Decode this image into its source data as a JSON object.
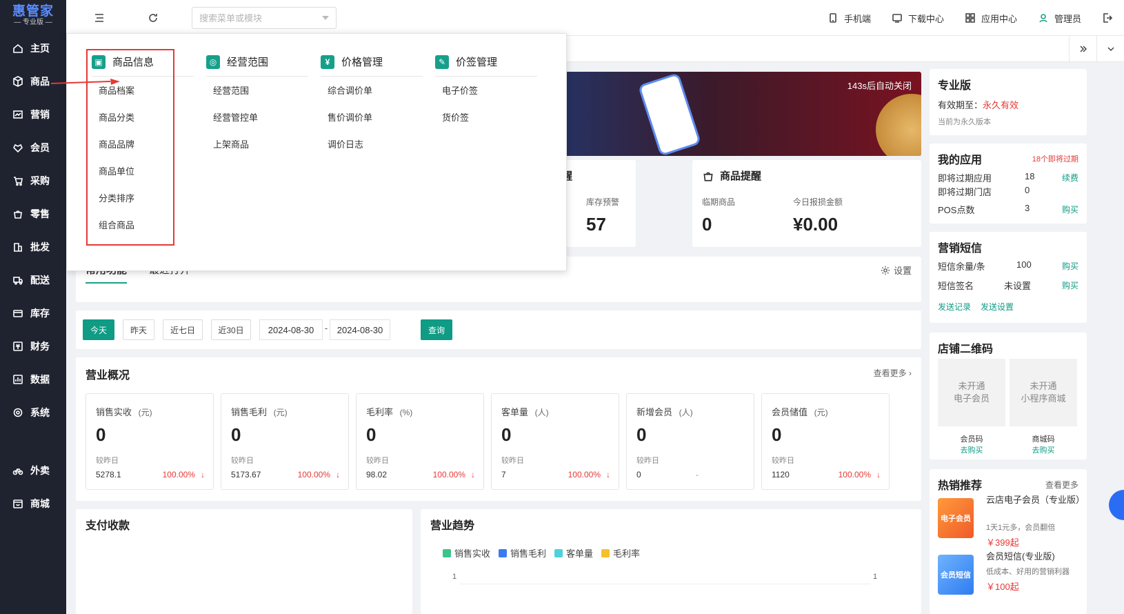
{
  "sidebar": {
    "brand": "惠管家",
    "edition": "— 专业版 —",
    "items": [
      {
        "label": "主页",
        "icon": "home-icon"
      },
      {
        "label": "商品",
        "icon": "cube-icon"
      },
      {
        "label": "营销",
        "icon": "chart-icon"
      },
      {
        "label": "会员",
        "icon": "heart-icon"
      },
      {
        "label": "采购",
        "icon": "cart-icon"
      },
      {
        "label": "零售",
        "icon": "bag-icon"
      },
      {
        "label": "批发",
        "icon": "building-icon"
      },
      {
        "label": "配送",
        "icon": "truck-icon"
      },
      {
        "label": "库存",
        "icon": "box-icon"
      },
      {
        "label": "财务",
        "icon": "money-icon"
      },
      {
        "label": "数据",
        "icon": "data-icon"
      },
      {
        "label": "系统",
        "icon": "gear-icon"
      },
      {
        "label": "外卖",
        "icon": "bike-icon"
      },
      {
        "label": "商城",
        "icon": "store-icon"
      }
    ]
  },
  "topbar": {
    "search_placeholder": "搜索菜单或模块",
    "mobile": "手机端",
    "download": "下载中心",
    "apps": "应用中心",
    "user": "管理员"
  },
  "mega_menu": {
    "columns": [
      {
        "title": "商品信息",
        "icon_char": "▣",
        "items": [
          "商品档案",
          "商品分类",
          "商品品牌",
          "商品单位",
          "分类排序",
          "组合商品"
        ]
      },
      {
        "title": "经营范围",
        "icon_char": "◎",
        "items": [
          "经营范围",
          "经营管控单",
          "上架商品"
        ]
      },
      {
        "title": "价格管理",
        "icon_char": "¥",
        "items": [
          "综合调价单",
          "售价调价单",
          "调价日志"
        ]
      },
      {
        "title": "价签管理",
        "icon_char": "✎",
        "items": [
          "电子价签",
          "货价签"
        ]
      }
    ]
  },
  "banner": {
    "countdown": "143s后自动关闭"
  },
  "stock_card": {
    "label": "库存预警",
    "value": "57",
    "title_frag": "提醒"
  },
  "goods_card": {
    "title": "商品提醒",
    "expiring_label": "临期商品",
    "expiring_value": "0",
    "loss_label": "今日报损金额",
    "loss_value": "¥0.00"
  },
  "functions": {
    "tabs": [
      "常用功能",
      "最近打开"
    ],
    "setting": "设置"
  },
  "filter": {
    "today": "今天",
    "yesterday": "昨天",
    "week": "近七日",
    "month": "近30日",
    "start": "2024-08-30",
    "sep": "-",
    "end": "2024-08-30",
    "query": "查询"
  },
  "overview": {
    "title": "营业概况",
    "more": "查看更多",
    "metrics": [
      {
        "label": "销售实收",
        "unit": "(元)",
        "value": "0",
        "cmp": "较昨日",
        "prev": "5278.1",
        "pct": "100.00%",
        "arrow": "↓"
      },
      {
        "label": "销售毛利",
        "unit": "(元)",
        "value": "0",
        "cmp": "较昨日",
        "prev": "5173.67",
        "pct": "100.00%",
        "arrow": "↓"
      },
      {
        "label": "毛利率",
        "unit": "(%)",
        "value": "0",
        "cmp": "较昨日",
        "prev": "98.02",
        "pct": "100.00%",
        "arrow": "↓"
      },
      {
        "label": "客单量",
        "unit": "(人)",
        "value": "0",
        "cmp": "较昨日",
        "prev": "7",
        "pct": "100.00%",
        "arrow": "↓"
      },
      {
        "label": "新增会员",
        "unit": "(人)",
        "value": "0",
        "cmp": "较昨日",
        "prev": "0",
        "pct": "-",
        "arrow": ""
      },
      {
        "label": "会员储值",
        "unit": "(元)",
        "value": "0",
        "cmp": "较昨日",
        "prev": "1120",
        "pct": "100.00%",
        "arrow": "↓"
      }
    ]
  },
  "payment": {
    "title": "支付收款"
  },
  "trend": {
    "title": "营业趋势",
    "legend": [
      {
        "name": "销售实收",
        "color": "#3cc48a"
      },
      {
        "name": "销售毛利",
        "color": "#3a7bf0"
      },
      {
        "name": "客单量",
        "color": "#4fd1d9"
      },
      {
        "name": "毛利率",
        "color": "#f5c02c"
      }
    ],
    "y_left": "1",
    "y_right": "1"
  },
  "pro": {
    "title": "专业版",
    "validity_label": "有效期至：",
    "validity_value": "永久有效",
    "note": "当前为永久版本"
  },
  "my_apps": {
    "title": "我的应用",
    "expiring": "18个即将过期",
    "rows": [
      {
        "label": "即将过期应用",
        "value": "18",
        "link": "续费"
      },
      {
        "label": "即将过期门店",
        "value": "0",
        "link": ""
      },
      {
        "label": "POS点数",
        "value": "3",
        "link": "购买"
      }
    ]
  },
  "sms": {
    "title": "营销短信",
    "rows": [
      {
        "label": "短信余量/条",
        "value": "100",
        "link": "购买"
      },
      {
        "label": "短信签名",
        "value": "未设置",
        "link": "购买"
      }
    ],
    "record": "发送记录",
    "settings": "发送设置"
  },
  "qr": {
    "title": "店铺二维码",
    "boxes": [
      {
        "line1": "未开通",
        "line2": "电子会员",
        "name": "会员码",
        "link": "去购买"
      },
      {
        "line1": "未开通",
        "line2": "小程序商城",
        "name": "商城码",
        "link": "去购买"
      }
    ]
  },
  "hot": {
    "title": "热销推荐",
    "more": "查看更多",
    "items": [
      {
        "name": "云店电子会员（专业版）",
        "desc": "1天1元多，会员翻倍",
        "price": "￥399起",
        "badge": "电子会员"
      },
      {
        "name": "会员短信(专业版)",
        "desc": "低成本、好用的营销利器",
        "price": "￥100起",
        "badge": "会员短信"
      }
    ]
  },
  "colors": {
    "accent": "#0f9b84",
    "danger": "#e53935",
    "sidebar": "#1f2330"
  }
}
